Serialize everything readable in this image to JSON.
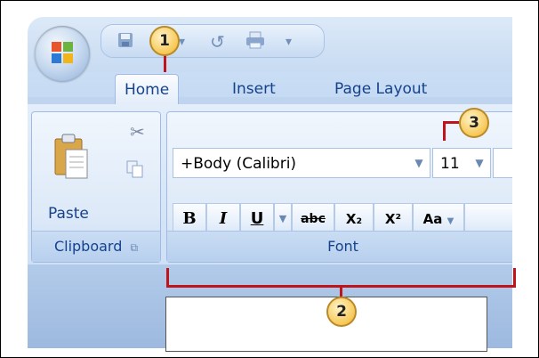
{
  "tabs": [
    {
      "label": "Home",
      "active": true
    },
    {
      "label": "Insert",
      "active": false
    },
    {
      "label": "Page Layout",
      "active": false
    }
  ],
  "qat": {
    "icons": [
      "save-icon",
      "undo-icon",
      "redo-icon",
      "print-icon",
      "customize-icon"
    ]
  },
  "clipboard": {
    "group_label": "Clipboard",
    "paste_label": "Paste"
  },
  "font": {
    "group_label": "Font",
    "font_name": "+Body (Calibri)",
    "font_size": "11",
    "buttons": {
      "bold": "B",
      "italic": "I",
      "underline": "U",
      "strike": "abc",
      "subscript": "X₂",
      "superscript": "X²",
      "change_case": "Aa"
    }
  },
  "callouts": [
    "1",
    "2",
    "3"
  ],
  "colors": {
    "accent_red": "#c0141c",
    "ribbon_text": "#15428b"
  }
}
